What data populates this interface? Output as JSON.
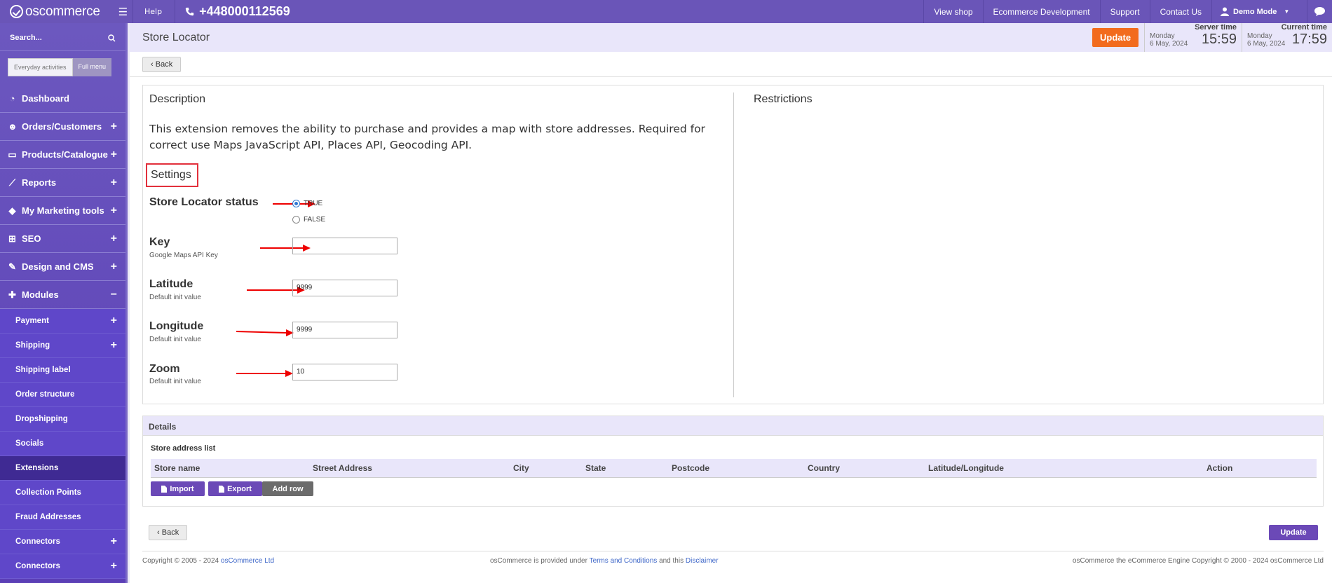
{
  "topbar": {
    "logo": "oscommerce",
    "help": "Help",
    "phone": "+448000112569",
    "links": [
      "View shop",
      "Ecommerce Development",
      "Support",
      "Contact Us"
    ],
    "user": "Demo Mode"
  },
  "sidebar": {
    "search_label": "Search...",
    "toggle_everyday": "Everyday activities",
    "toggle_full": "Full menu",
    "items": [
      {
        "label": "Dashboard",
        "icon": "dashboard-icon"
      },
      {
        "label": "Orders/Customers",
        "icon": "users-icon"
      },
      {
        "label": "Products/Catalogue",
        "icon": "folder-icon"
      },
      {
        "label": "Reports",
        "icon": "chart-icon"
      },
      {
        "label": "My Marketing tools",
        "icon": "tag-icon"
      },
      {
        "label": "SEO",
        "icon": "sitemap-icon"
      },
      {
        "label": "Design and CMS",
        "icon": "brush-icon"
      },
      {
        "label": "Modules",
        "icon": "puzzle-icon"
      }
    ],
    "subitems": [
      {
        "label": "Payment"
      },
      {
        "label": "Shipping"
      },
      {
        "label": "Shipping label"
      },
      {
        "label": "Order structure"
      },
      {
        "label": "Dropshipping"
      },
      {
        "label": "Socials"
      },
      {
        "label": "Extensions"
      },
      {
        "label": "Collection Points"
      },
      {
        "label": "Fraud Addresses"
      },
      {
        "label": "Connectors"
      },
      {
        "label": "Connectors"
      }
    ]
  },
  "header": {
    "title": "Store Locator",
    "update": "Update",
    "server_time_label": "Server time",
    "server_day": "Monday",
    "server_date": "6 May, 2024",
    "server_time": "15:59",
    "current_time_label": "Current time",
    "current_day": "Monday",
    "current_date": "6 May, 2024",
    "current_time": "17:59"
  },
  "main": {
    "back": "Back",
    "description_title": "Description",
    "description": "This extension removes the ability to purchase and provides a map with store addresses. Required for correct use Maps JavaScript API, Places API, Geocoding API.",
    "restrictions_title": "Restrictions",
    "settings_title": "Settings",
    "status_label": "Store Locator status",
    "true_label": "TRUE",
    "false_label": "FALSE",
    "key_label": "Key",
    "key_sub": "Google Maps API Key",
    "key_value": "",
    "lat_label": "Latitude",
    "lat_sub": "Default init value",
    "lat_value": "9999",
    "lng_label": "Longitude",
    "lng_sub": "Default init value",
    "lng_value": "9999",
    "zoom_label": "Zoom",
    "zoom_sub": "Default init value",
    "zoom_value": "10"
  },
  "details": {
    "title": "Details",
    "list_title": "Store address list",
    "columns": [
      "Store name",
      "Street Address",
      "City",
      "State",
      "Postcode",
      "Country",
      "Latitude/Longitude",
      "Action"
    ],
    "import": "Import",
    "export": "Export",
    "add_row": "Add row"
  },
  "bottom": {
    "back": "Back",
    "update": "Update"
  },
  "footer": {
    "copy_prefix": "Copyright © 2005 - 2024",
    "copy_link": "osCommerce Ltd",
    "middle_prefix": "osCommerce is provided under",
    "terms": "Terms and Conditions",
    "and_this": "and this",
    "disclaimer": "Disclaimer",
    "right": "osCommerce the eCommerce Engine Copyright © 2000 - 2024 osCommerce Ltd"
  }
}
